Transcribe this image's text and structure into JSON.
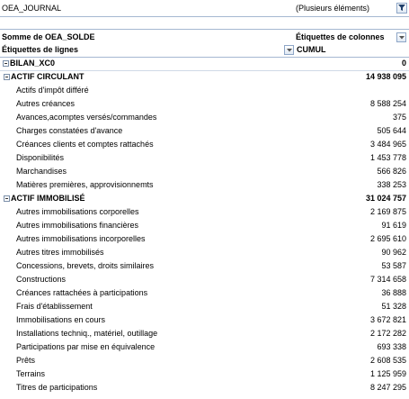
{
  "filter": {
    "label": "OEA_JOURNAL",
    "value": "(Plusieurs éléments)"
  },
  "pivot": {
    "values_field": "Somme de OEA_SOLDE",
    "column_labels": "Étiquettes de colonnes",
    "row_labels": "Étiquettes de lignes",
    "column_item": "CUMUL"
  },
  "rows": [
    {
      "label": "BILAN_XC0",
      "value": "0"
    },
    {
      "label": "ACTIF CIRCULANT",
      "value": "14 938 095"
    },
    {
      "label": "Actifs d'impôt différé",
      "value": ""
    },
    {
      "label": "Autres créances",
      "value": "8 588 254"
    },
    {
      "label": "Avances,acomptes versés/commandes",
      "value": "375"
    },
    {
      "label": "Charges constatées d'avance",
      "value": "505 644"
    },
    {
      "label": "Créances clients et comptes rattachés",
      "value": "3 484 965"
    },
    {
      "label": "Disponibilités",
      "value": "1 453 778"
    },
    {
      "label": "Marchandises",
      "value": "566 826"
    },
    {
      "label": "Matières premières, approvisionnemts",
      "value": "338 253"
    },
    {
      "label": "ACTIF IMMOBILISÉ",
      "value": "31 024 757"
    },
    {
      "label": "Autres immobilisations corporelles",
      "value": "2 169 875"
    },
    {
      "label": "Autres immobilisations financières",
      "value": "91 619"
    },
    {
      "label": "Autres immobilisations incorporelles",
      "value": "2 695 610"
    },
    {
      "label": "Autres titres immobilisés",
      "value": "90 962"
    },
    {
      "label": "Concessions, brevets, droits similaires",
      "value": "53 587"
    },
    {
      "label": "Constructions",
      "value": "7 314 658"
    },
    {
      "label": "Créances rattachées à participations",
      "value": "36 888"
    },
    {
      "label": "Frais d'établissement",
      "value": "51 328"
    },
    {
      "label": "Immobilisations en cours",
      "value": "3 672 821"
    },
    {
      "label": "Installations techniq., matériel, outillage",
      "value": "2 172 282"
    },
    {
      "label": "Participations par mise en équivalence",
      "value": "693 338"
    },
    {
      "label": "Prêts",
      "value": "2 608 535"
    },
    {
      "label": "Terrains",
      "value": "1 125 959"
    },
    {
      "label": "Titres de participations",
      "value": "8 247 295"
    }
  ]
}
